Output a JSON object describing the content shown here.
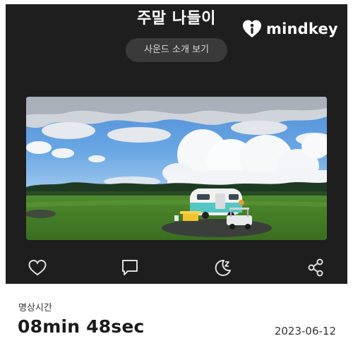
{
  "header": {
    "title": "주말 나들이",
    "sound_button_label": "사운드 소개 보기"
  },
  "brand": {
    "name": "mindkey",
    "color": "#ffffff"
  },
  "photo": {
    "subject": "camper-van-on-grass-field"
  },
  "actions": {
    "icons": [
      "heart-icon",
      "comment-icon",
      "moon-sleep-icon",
      "share-icon"
    ]
  },
  "session": {
    "label": "명상시간",
    "duration": "08min 48sec",
    "date": "2023-06-12"
  },
  "colors": {
    "panel_background": "#1e1e1e",
    "button_background": "#3a3a3a",
    "page_background": "#ffffff"
  }
}
